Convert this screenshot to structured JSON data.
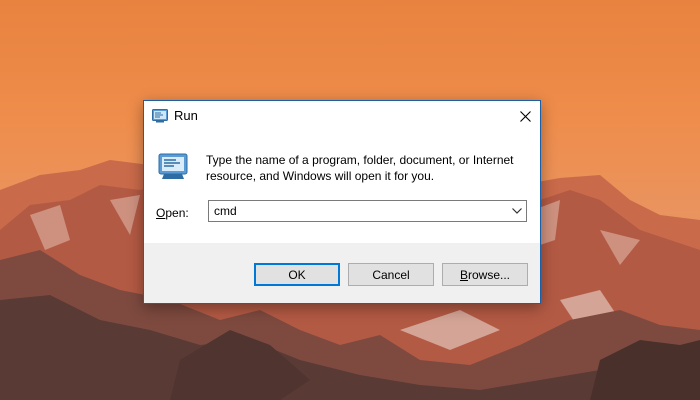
{
  "window": {
    "title": "Run"
  },
  "dialog": {
    "description": "Type the name of a program, folder, document, or Internet resource, and Windows will open it for you.",
    "open_label_prefix": "O",
    "open_label_rest": "pen:",
    "input_value": "cmd",
    "buttons": {
      "ok": "OK",
      "cancel": "Cancel",
      "browse_prefix": "B",
      "browse_rest": "rowse..."
    }
  },
  "icons": {
    "title": "run-app-icon",
    "large": "run-app-icon",
    "close": "close-icon",
    "dropdown": "chevron-down-icon"
  },
  "colors": {
    "accent": "#0078d7",
    "dialog_border": "#1a5fa8",
    "button_face": "#e1e1e1",
    "footer_bg": "#f0f0f0"
  }
}
